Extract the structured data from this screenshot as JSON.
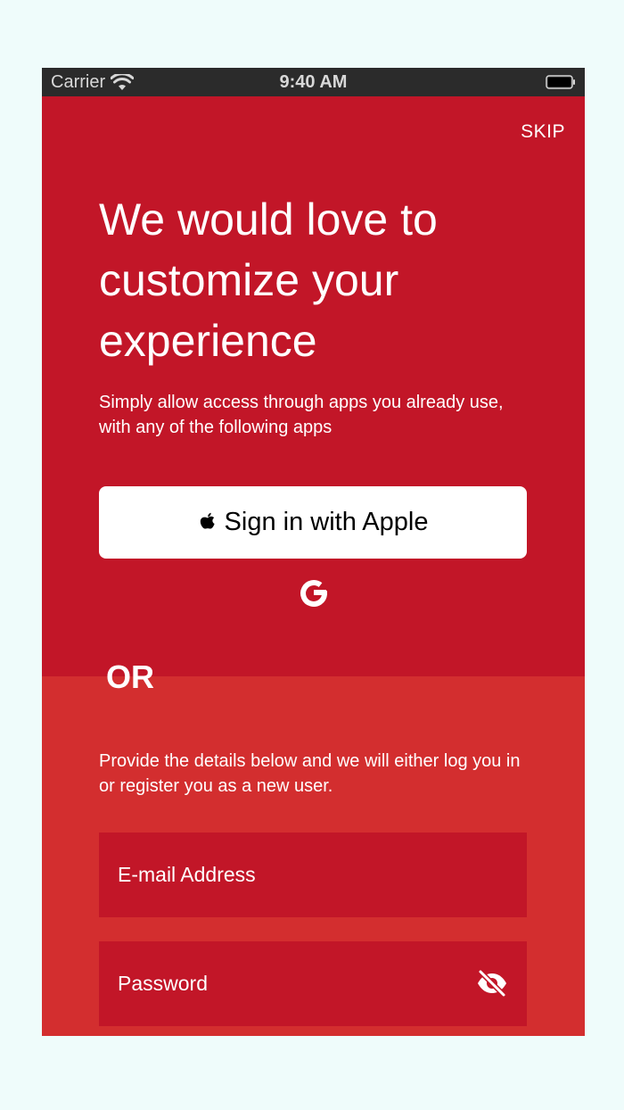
{
  "status_bar": {
    "carrier": "Carrier",
    "time": "9:40 AM",
    "wifi_icon": "wifi-icon",
    "battery_icon": "battery-icon"
  },
  "header": {
    "skip_label": "SKIP",
    "headline": "We would love to customize your experience",
    "subtitle": "Simply allow access through apps you already use, with any of the following apps"
  },
  "social": {
    "apple_label": "Sign in with Apple",
    "apple_icon": "apple-icon",
    "google_icon": "google-icon"
  },
  "divider": {
    "or_label": "OR"
  },
  "form": {
    "details_text": "Provide the details below and we will either log you in or register you as a new user.",
    "email_placeholder": "E-mail Address",
    "email_value": "",
    "password_placeholder": "Password",
    "password_value": "",
    "visibility_icon": "eye-off-icon"
  },
  "colors": {
    "page_background": "#effcfb",
    "top_red": "#c21628",
    "bottom_red": "#d32e2f",
    "input_background": "#c21628",
    "button_background": "#ffffff"
  }
}
